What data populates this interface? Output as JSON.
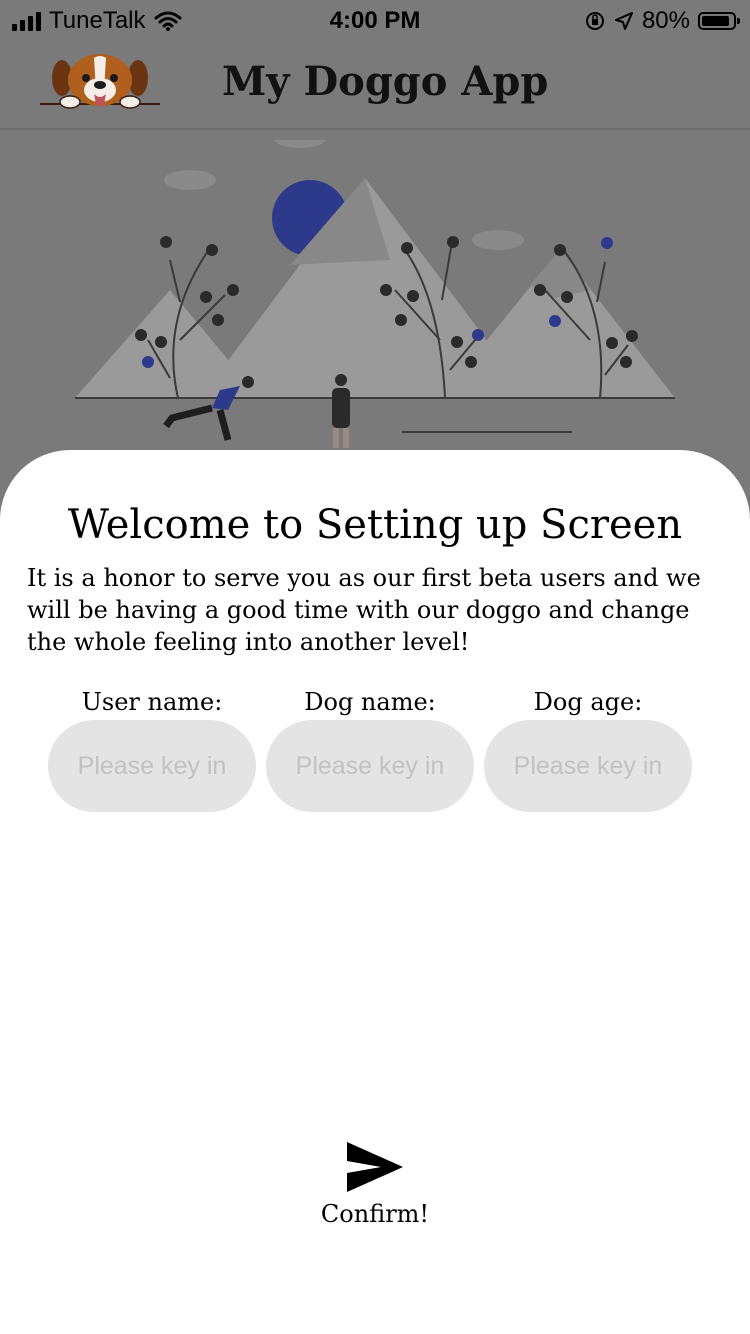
{
  "status_bar": {
    "carrier": "TuneTalk",
    "time": "4:00 PM",
    "battery": "80%"
  },
  "header": {
    "title": "My Doggo App",
    "logo_icon": "beagle-dog-logo"
  },
  "illustration": {
    "icon": "people-walking-mountains-illustration"
  },
  "setup": {
    "heading": "Welcome to Setting up Screen",
    "intro": "It is a honor to serve you as our first beta users and we will be having a good time with our doggo and change the whole feeling into another level!",
    "fields": [
      {
        "label": "User name:",
        "placeholder": "Please key in",
        "value": ""
      },
      {
        "label": "Dog name:",
        "placeholder": "Please key in",
        "value": ""
      },
      {
        "label": "Dog age:",
        "placeholder": "Please key in",
        "value": ""
      }
    ],
    "confirm_label": "Confirm!",
    "confirm_icon": "send-arrow-icon"
  },
  "colors": {
    "overlay": "#7a7a7a",
    "sheet": "#ffffff",
    "input_bg": "#e4e4e4",
    "accent_blue": "#2d3a8c"
  }
}
